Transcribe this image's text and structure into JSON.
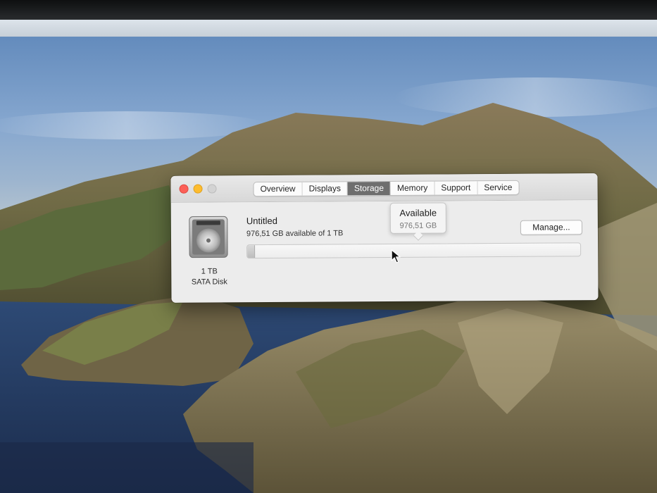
{
  "window": {
    "tabs": [
      {
        "label": "Overview",
        "active": false
      },
      {
        "label": "Displays",
        "active": false
      },
      {
        "label": "Storage",
        "active": true
      },
      {
        "label": "Memory",
        "active": false
      },
      {
        "label": "Support",
        "active": false
      },
      {
        "label": "Service",
        "active": false
      }
    ],
    "controls": {
      "close": "close-icon",
      "minimize": "minimize-icon",
      "zoom": "zoom-icon"
    }
  },
  "storage": {
    "disk_icon": "hard-disk-icon",
    "disk_size": "1 TB",
    "disk_type": "SATA Disk",
    "volume_name": "Untitled",
    "available_text": "976,51 GB available of 1 TB",
    "manage_label": "Manage...",
    "used_fraction": 0.024,
    "tooltip": {
      "title": "Available",
      "value": "976,51 GB"
    }
  },
  "colors": {
    "close": "#fc5f57",
    "minimize": "#fdbc2e",
    "zoom_inactive": "#d3d3d3",
    "active_tab": "#6e6e6e"
  }
}
